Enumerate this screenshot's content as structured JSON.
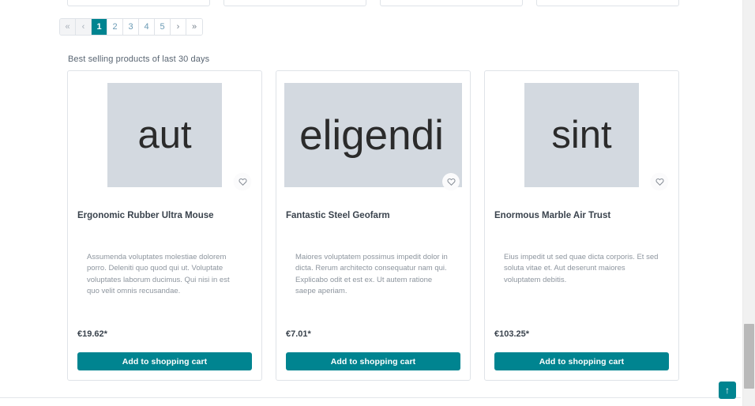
{
  "pagination": {
    "first_label": "«",
    "prev_label": "‹",
    "next_label": "›",
    "last_label": "»",
    "pages": [
      "1",
      "2",
      "3",
      "4",
      "5"
    ],
    "active_page": "1"
  },
  "section": {
    "title": "Best selling products of last 30 days"
  },
  "products": [
    {
      "image_text": "aut",
      "title": "Ergonomic Rubber Ultra Mouse",
      "description": "Assumenda voluptates molestiae dolorem porro. Deleniti quo quod qui ut. Voluptate voluptates laborum ducimus. Qui nisi in est quo velit omnis recusandae.",
      "price": "€19.62*",
      "cart_label": "Add to shopping cart"
    },
    {
      "image_text": "eligendi",
      "title": "Fantastic Steel Geofarm",
      "description": "Maiores voluptatem possimus impedit dolor in dicta. Rerum architecto consequatur nam qui. Explicabo odit et est ex. Ut autem ratione saepe aperiam.",
      "price": "€7.01*",
      "cart_label": "Add to shopping cart"
    },
    {
      "image_text": "sint",
      "title": "Enormous Marble Air Trust",
      "description": "Eius impedit ut sed quae dicta corporis. Et sed soluta vitae et. Aut deserunt maiores voluptatem debitis.",
      "price": "€103.25*",
      "cart_label": "Add to shopping cart"
    }
  ],
  "scroll_top": {
    "label": "↑"
  },
  "colors": {
    "accent": "#008490",
    "image_placeholder": "#d3d9e0",
    "border": "#dfe3e8",
    "text_primary": "#3a434d",
    "text_muted": "#8d959e"
  }
}
